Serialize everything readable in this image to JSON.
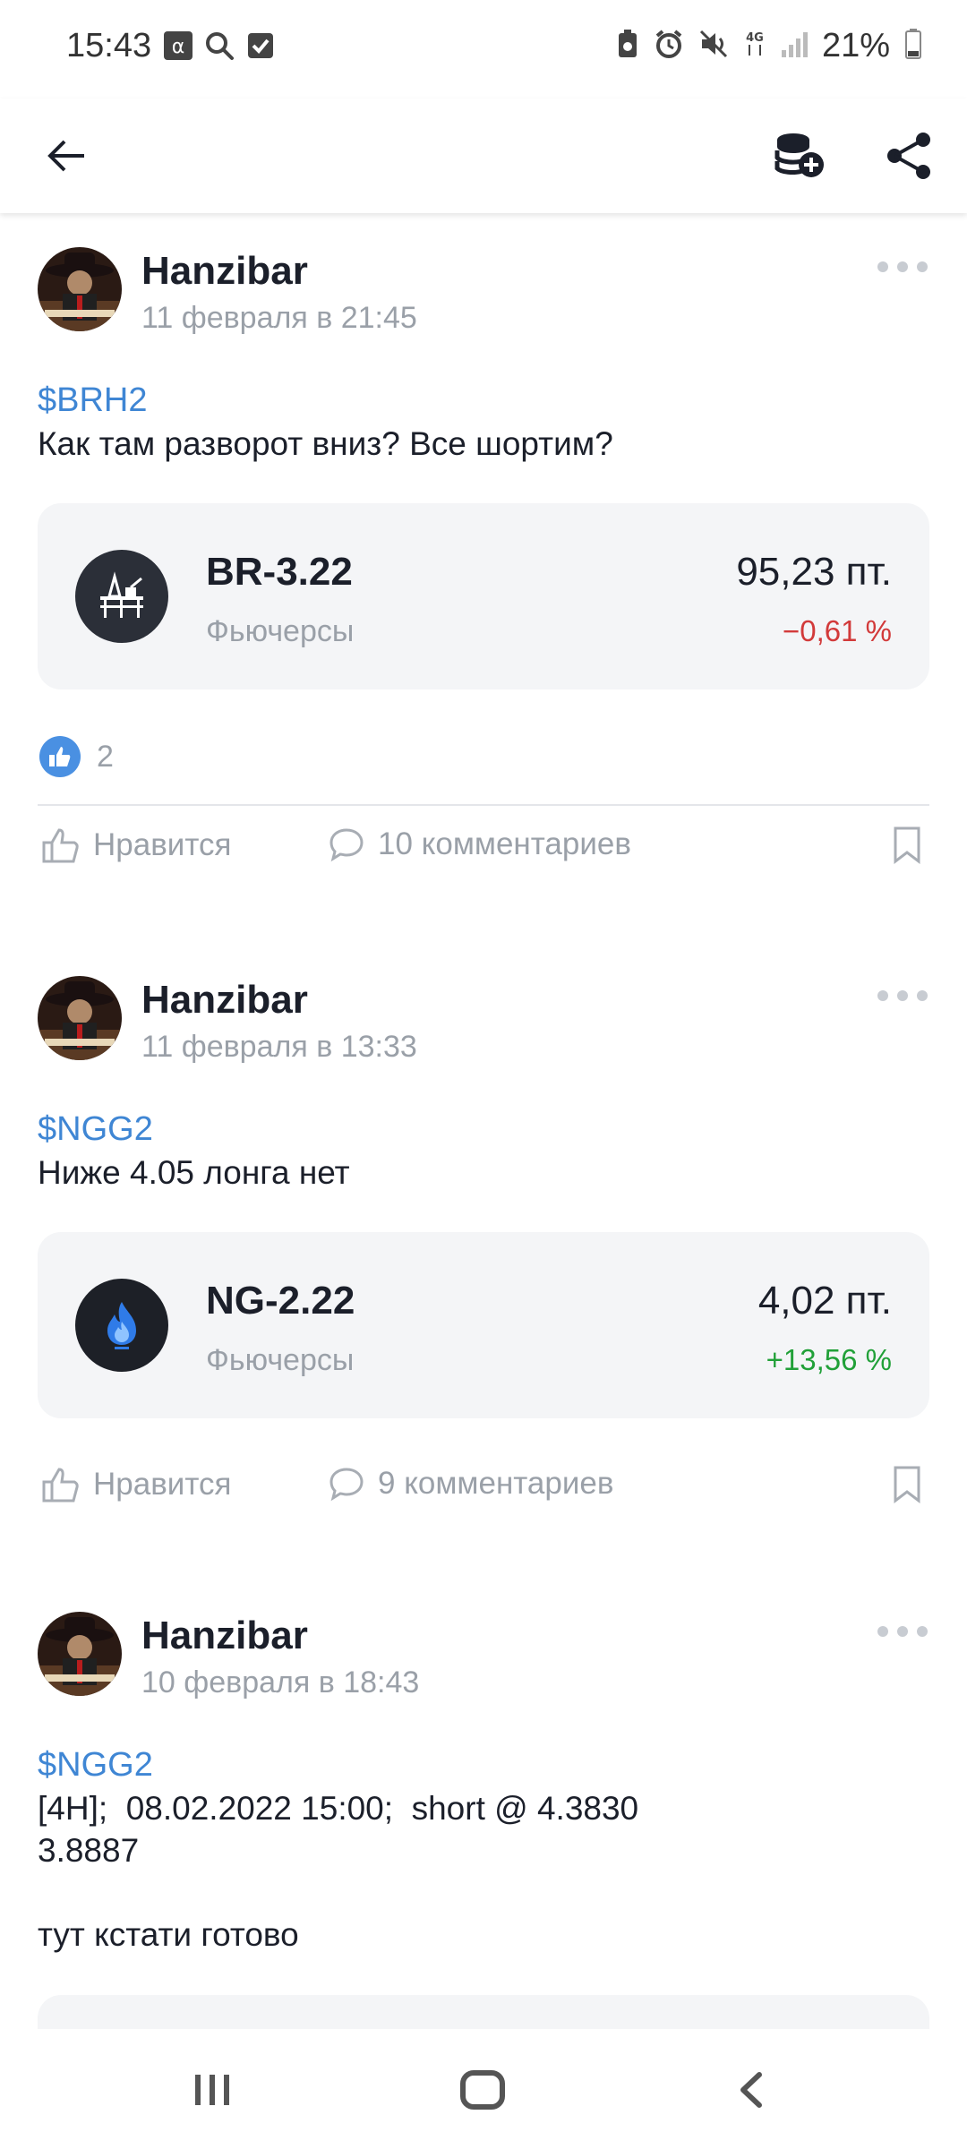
{
  "status_bar": {
    "time": "15:43",
    "left_icons": [
      "alpha-icon",
      "search-icon",
      "checkbox-icon"
    ],
    "right_icons": [
      "battery-saver-icon",
      "alarm-icon",
      "mute-icon",
      "4g-icon",
      "signal-icon"
    ],
    "battery_text": "21%"
  },
  "app_bar": {
    "icons": [
      "back-arrow-icon",
      "add-coins-icon",
      "share-icon"
    ]
  },
  "posts": [
    {
      "author": "Hanzibar",
      "date": "11 февраля в 21:45",
      "ticker": "$BRH2",
      "text": "Как там разворот вниз? Все шортим?",
      "card": {
        "symbol": "BR-3.22",
        "category": "Фьючерсы",
        "price": "95,23  пт.",
        "change": "−0,61 %",
        "change_color": "#d23a3a",
        "icon_bg": "#2b2f38"
      },
      "likes_count": "2",
      "like_label": "Нравится",
      "comments_label": "10 комментариев"
    },
    {
      "author": "Hanzibar",
      "date": "11 февраля в 13:33",
      "ticker": "$NGG2",
      "text": "Ниже 4.05 лонга нет",
      "card": {
        "symbol": "NG-2.22",
        "category": "Фьючерсы",
        "price": "4,02  пт.",
        "change": "+13,56 %",
        "change_color": "#21a038",
        "icon_bg": "#1d2027"
      },
      "like_label": "Нравится",
      "comments_label": "9 комментариев"
    },
    {
      "author": "Hanzibar",
      "date": "10 февраля в 18:43",
      "ticker": "$NGG2",
      "text_lines": [
        "[4H];  08.02.2022 15:00;  short @ 4.3830",
        "3.8887",
        "",
        "тут кстати готово"
      ]
    }
  ],
  "nav_bar": {
    "icons": [
      "recent-apps-icon",
      "home-icon",
      "back-icon"
    ]
  },
  "colors": {
    "accent_link": "#3f86d4",
    "muted": "#9aa0a8",
    "card_bg": "#f4f5f7",
    "negative": "#d23a3a",
    "positive": "#21a038"
  }
}
